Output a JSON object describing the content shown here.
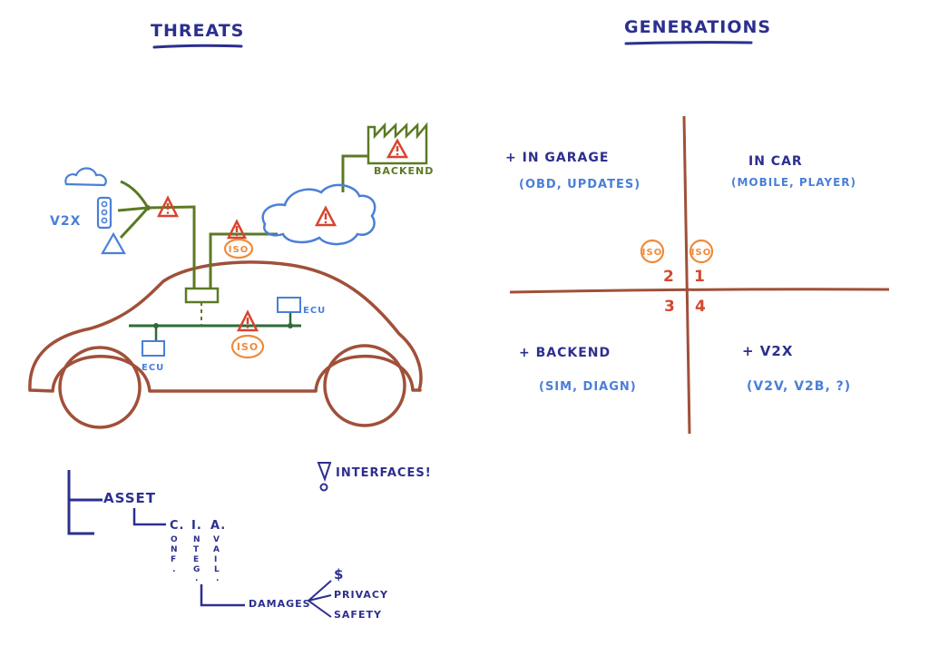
{
  "threats": {
    "title": "THREATS",
    "v2x_label": "V2X",
    "backend_label": "BACKEND",
    "ecu_labels": [
      "ECU",
      "ECU"
    ],
    "iso_badge": "ISO",
    "interfaces_label": "INTERFACES!"
  },
  "tree": {
    "asset": "ASSET",
    "cia_letters": [
      "C.",
      "I.",
      "A."
    ],
    "cia_expansions": [
      {
        "letters": [
          "O",
          "N",
          "F",
          "."
        ]
      },
      {
        "letters": [
          "N",
          "T",
          "E",
          "G",
          "."
        ]
      },
      {
        "letters": [
          "V",
          "A",
          "I",
          "L",
          "."
        ]
      }
    ],
    "damages": "DAMAGES",
    "damage_types": [
      "$",
      "PRIVACY",
      "SAFETY"
    ]
  },
  "generations": {
    "title": "GENERATIONS",
    "quadrants": [
      {
        "number": "1",
        "title": "IN CAR",
        "subtitle": "(MOBILE, PLAYER)"
      },
      {
        "number": "2",
        "title": "+ IN GARAGE",
        "subtitle": "(OBD, UPDATES)"
      },
      {
        "number": "3",
        "title": "+ BACKEND",
        "subtitle": "(SIM, DIAGN)"
      },
      {
        "number": "4",
        "title": "+ V2X",
        "subtitle": "(V2V, V2B, ?)"
      }
    ],
    "iso_badge": "ISO"
  },
  "colors": {
    "navy": "#2c2f8f",
    "blue": "#4a7fd8",
    "olive": "#5b7a23",
    "car_brown": "#a0503a",
    "warning_red": "#d8442e",
    "iso_orange": "#ef8a3a"
  }
}
